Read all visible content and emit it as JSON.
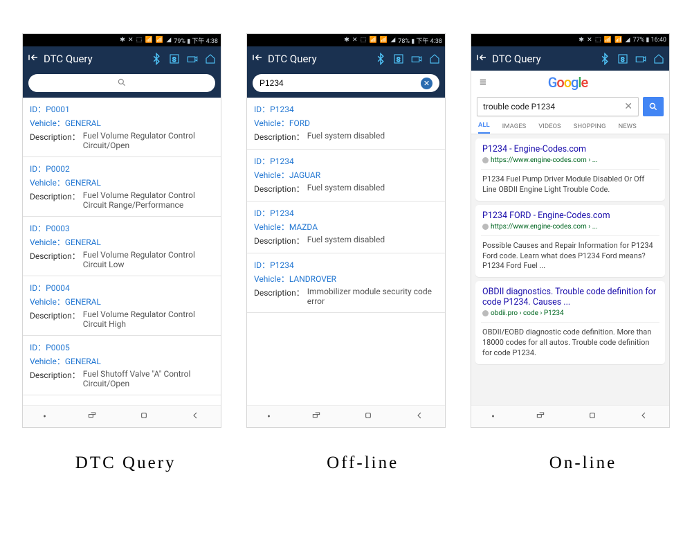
{
  "phoneA": {
    "status": "79% ▮ 下午 4:38",
    "title": "DTC Query",
    "search_value": "",
    "search_placeholder": "",
    "id_label": "ID：",
    "veh_label": "Vehicle：",
    "desc_label": "Description：",
    "items": [
      {
        "id": "P0001",
        "veh": "GENERAL",
        "desc": "Fuel Volume Regulator Control Circuit/Open"
      },
      {
        "id": "P0002",
        "veh": "GENERAL",
        "desc": "Fuel Volume Regulator Control Circuit Range/Performance"
      },
      {
        "id": "P0003",
        "veh": "GENERAL",
        "desc": "Fuel Volume Regulator Control Circuit Low"
      },
      {
        "id": "P0004",
        "veh": "GENERAL",
        "desc": "Fuel Volume Regulator Control Circuit High"
      },
      {
        "id": "P0005",
        "veh": "GENERAL",
        "desc": "Fuel Shutoff Valve \"A\" Control Circuit/Open"
      }
    ]
  },
  "phoneB": {
    "status": "78% ▮ 下午 4:38",
    "title": "DTC Query",
    "search_value": "P1234",
    "id_label": "ID：",
    "veh_label": "Vehicle：",
    "desc_label": "Description：",
    "items": [
      {
        "id": "P1234",
        "veh": "FORD",
        "desc": "Fuel system disabled"
      },
      {
        "id": "P1234",
        "veh": "JAGUAR",
        "desc": "Fuel system disabled"
      },
      {
        "id": "P1234",
        "veh": "MAZDA",
        "desc": "Fuel system disabled"
      },
      {
        "id": "P1234",
        "veh": "LANDROVER",
        "desc": "Immobilizer module security code error"
      }
    ]
  },
  "phoneC": {
    "status": "77% ▮ 16:40",
    "title": "DTC Query",
    "gsearch": "trouble code P1234",
    "tabs": [
      "ALL",
      "IMAGES",
      "VIDEOS",
      "SHOPPING",
      "NEWS"
    ],
    "results": [
      {
        "title": "P1234 - Engine-Codes.com",
        "url": "https://www.engine-codes.com › ...",
        "snippet": "P1234 Fuel Pump Driver Module Disabled Or Off Line OBDII Engine Light Trouble Code."
      },
      {
        "title": "P1234 FORD - Engine-Codes.com",
        "url": "https://www.engine-codes.com › ...",
        "snippet": "Possible Causes and Repair Information for P1234 Ford code. Learn what does P1234 Ford means? P1234 Ford Fuel ..."
      },
      {
        "title": "OBDII diagnostics. Trouble code definition for code P1234. Causes ...",
        "url": "obdii.pro › code › P1234",
        "snippet": "OBDII/EOBD diagnostic code definition. More than 18000 codes for all autos. Trouble code definition for code P1234."
      }
    ]
  },
  "captions": {
    "a": "DTC Query",
    "b": "Off-line",
    "c": "On-line"
  }
}
